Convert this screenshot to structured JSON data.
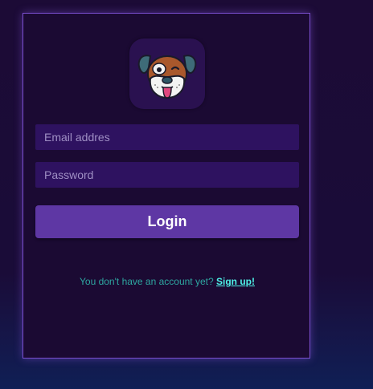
{
  "login_form": {
    "logo_icon": "dog-face-icon",
    "email_placeholder": "Email addres",
    "email_value": "",
    "password_placeholder": "Password",
    "password_value": "",
    "login_label": "Login",
    "signup_prompt": "You don't have an account yet?",
    "signup_link": "Sign up!"
  },
  "colors": {
    "background": "#1c0b36",
    "card_border": "#7b4fd0",
    "input_background": "#2e1260",
    "button": "#5e37a4",
    "prompt_text": "#2ea7a1",
    "link_text": "#4ef0e6"
  }
}
